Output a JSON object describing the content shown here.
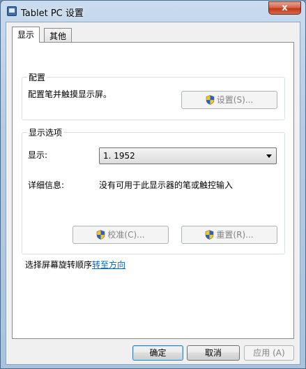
{
  "window": {
    "title": "Tablet PC 设置",
    "close_label": "x"
  },
  "tabs": [
    {
      "label": "显示",
      "active": true
    },
    {
      "label": "其他",
      "active": false
    }
  ],
  "config_group": {
    "title": "配置",
    "description": "配置笔并触摸显示屏。",
    "setup_button": "设置(S)..."
  },
  "display_group": {
    "title": "显示选项",
    "display_label": "显示:",
    "display_value": "1. 1952",
    "details_label": "详细信息:",
    "details_value": "没有可用于此显示器的笔或触控输入",
    "calibrate_button": "校准(C)...",
    "reset_button": "重置(R)..."
  },
  "rotation": {
    "prefix": "选择屏幕旋转顺序",
    "link": "转至方向"
  },
  "footer": {
    "ok_button": "确定",
    "cancel_button": "取消",
    "apply_button": "应用 (A)"
  },
  "colors": {
    "link": "#0066cc",
    "shield_blue": "#2a61c6",
    "shield_yellow": "#f3c72a"
  }
}
